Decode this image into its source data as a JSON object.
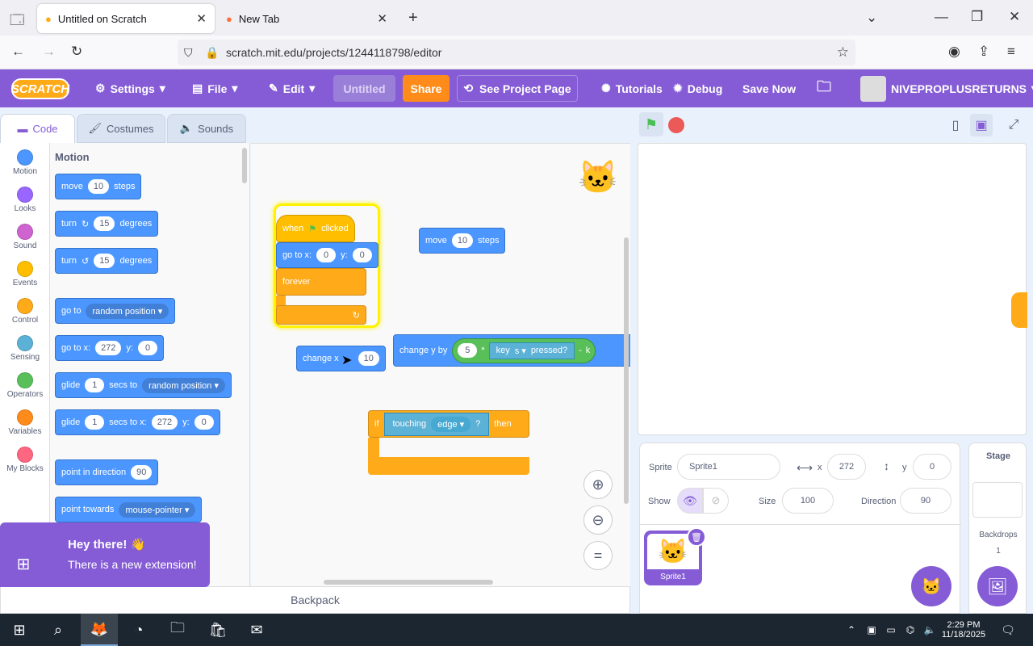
{
  "browser": {
    "tabs": [
      {
        "label": "Untitled on Scratch"
      },
      {
        "label": "New Tab"
      }
    ],
    "url": "scratch.mit.edu/projects/1244118798/editor"
  },
  "menu": {
    "logo": "SCRATCH",
    "settings": "Settings",
    "file": "File",
    "edit": "Edit",
    "title": "Untitled",
    "share": "Share",
    "see_project": "See Project Page",
    "tutorials": "Tutorials",
    "debug": "Debug",
    "save_now": "Save Now",
    "user": "NIVEPROPLUSRETURNS"
  },
  "editor_tabs": {
    "code": "Code",
    "costumes": "Costumes",
    "sounds": "Sounds"
  },
  "categories": [
    {
      "label": "Motion",
      "color": "#4c97ff"
    },
    {
      "label": "Looks",
      "color": "#9966ff"
    },
    {
      "label": "Sound",
      "color": "#cf63cf"
    },
    {
      "label": "Events",
      "color": "#ffbf00"
    },
    {
      "label": "Control",
      "color": "#ffab19"
    },
    {
      "label": "Sensing",
      "color": "#5cb1d6"
    },
    {
      "label": "Operators",
      "color": "#59c059"
    },
    {
      "label": "Variables",
      "color": "#ff8c1a"
    },
    {
      "label": "My Blocks",
      "color": "#ff6680"
    }
  ],
  "palette": {
    "heading": "Motion",
    "move": {
      "a": "move",
      "v": "10",
      "b": "steps"
    },
    "turn_cw": {
      "a": "turn",
      "v": "15",
      "b": "degrees"
    },
    "turn_ccw": {
      "a": "turn",
      "v": "15",
      "b": "degrees"
    },
    "goto": {
      "a": "go to",
      "d": "random position"
    },
    "gotoxy": {
      "a": "go to x:",
      "x": "272",
      "b": "y:",
      "y": "0"
    },
    "glide_to": {
      "a": "glide",
      "v": "1",
      "b": "secs to",
      "d": "random position"
    },
    "glide_xy": {
      "a": "glide",
      "v": "1",
      "b": "secs to x:",
      "x": "272",
      "c": "y:",
      "y": "0"
    },
    "point_dir": {
      "a": "point in direction",
      "v": "90"
    },
    "point_towards": {
      "a": "point towards",
      "d": "mouse-pointer"
    }
  },
  "workspace": {
    "hat": {
      "a": "when",
      "b": "clicked"
    },
    "gotoxy": {
      "a": "go to x:",
      "x": "0",
      "b": "y:",
      "y": "0"
    },
    "forever": "forever",
    "move": {
      "a": "move",
      "v": "10",
      "b": "steps"
    },
    "changex": {
      "a": "change x",
      "v": "10"
    },
    "changey": {
      "a": "change y by",
      "v": "5",
      "op": "*",
      "key": "key",
      "keyv": "s",
      "pressed": "pressed?",
      "minus": "-",
      "k": "k"
    },
    "if": {
      "a": "if",
      "touching": "touching",
      "edge": "edge",
      "q": "?",
      "then": "then"
    }
  },
  "backpack": "Backpack",
  "toast": {
    "title": "Hey there! 👋",
    "body": "There is a new extension!"
  },
  "sprite": {
    "label": "Sprite",
    "name": "Sprite1",
    "x_label": "x",
    "x": "272",
    "y_label": "y",
    "y": "0",
    "show_label": "Show",
    "size_label": "Size",
    "size": "100",
    "dir_label": "Direction",
    "direction": "90",
    "thumb_name": "Sprite1"
  },
  "stage_pane": {
    "label": "Stage",
    "backdrops_label": "Backdrops",
    "backdrops": "1"
  },
  "taskbar": {
    "time": "2:29 PM",
    "date": "11/18/2025"
  }
}
